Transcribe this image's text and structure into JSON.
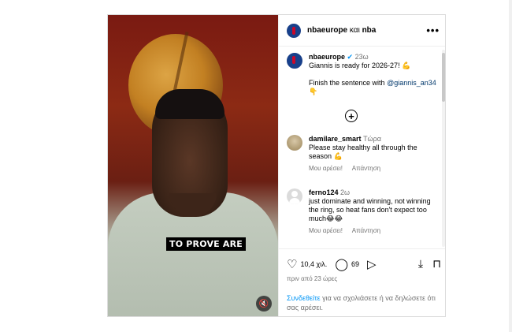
{
  "header": {
    "account": "nbaeurope",
    "connector": "και",
    "collaborator": "nba",
    "more": "•••"
  },
  "post": {
    "author": "nbaeurope",
    "verified_icon": "✔",
    "time": "23ω",
    "line1": "Giannis is ready for 2026-27! 💪",
    "line2_prefix": "Finish the sentence with ",
    "mention": "@giannis_an34",
    "line2_emoji": "👇"
  },
  "video": {
    "caption": "TO PROVE ARE",
    "mute_icon": "🔇"
  },
  "load_more_icon": "+",
  "comments": [
    {
      "user": "damilare_smart",
      "time": "Τώρα",
      "text": "Please stay healthy all through the season 💪",
      "like": "Μου αρέσει!",
      "reply": "Απάντηση"
    },
    {
      "user": "ferno124",
      "time": "2ω",
      "text": "just dominate and winning, not winning the ring, so heat fans don't expect too much😂😂",
      "like": "Μου αρέσει!",
      "reply": "Απάντηση"
    }
  ],
  "actions": {
    "likes": "10,4 χιλ.",
    "comments_count": "69",
    "heart_icon": "♡",
    "comment_icon": "◯",
    "share_icon": "▷",
    "download_icon": "⤓",
    "bookmark_icon": "⊓",
    "ago": "πριν από 23 ώρες"
  },
  "login": {
    "link": "Συνδεθείτε",
    "rest": " για να σχολιάσετε ή να δηλώσετε ότι σας αρέσει."
  },
  "colors": {
    "link": "#00376b",
    "login_link": "#0095f6",
    "verified": "#0095f6"
  }
}
